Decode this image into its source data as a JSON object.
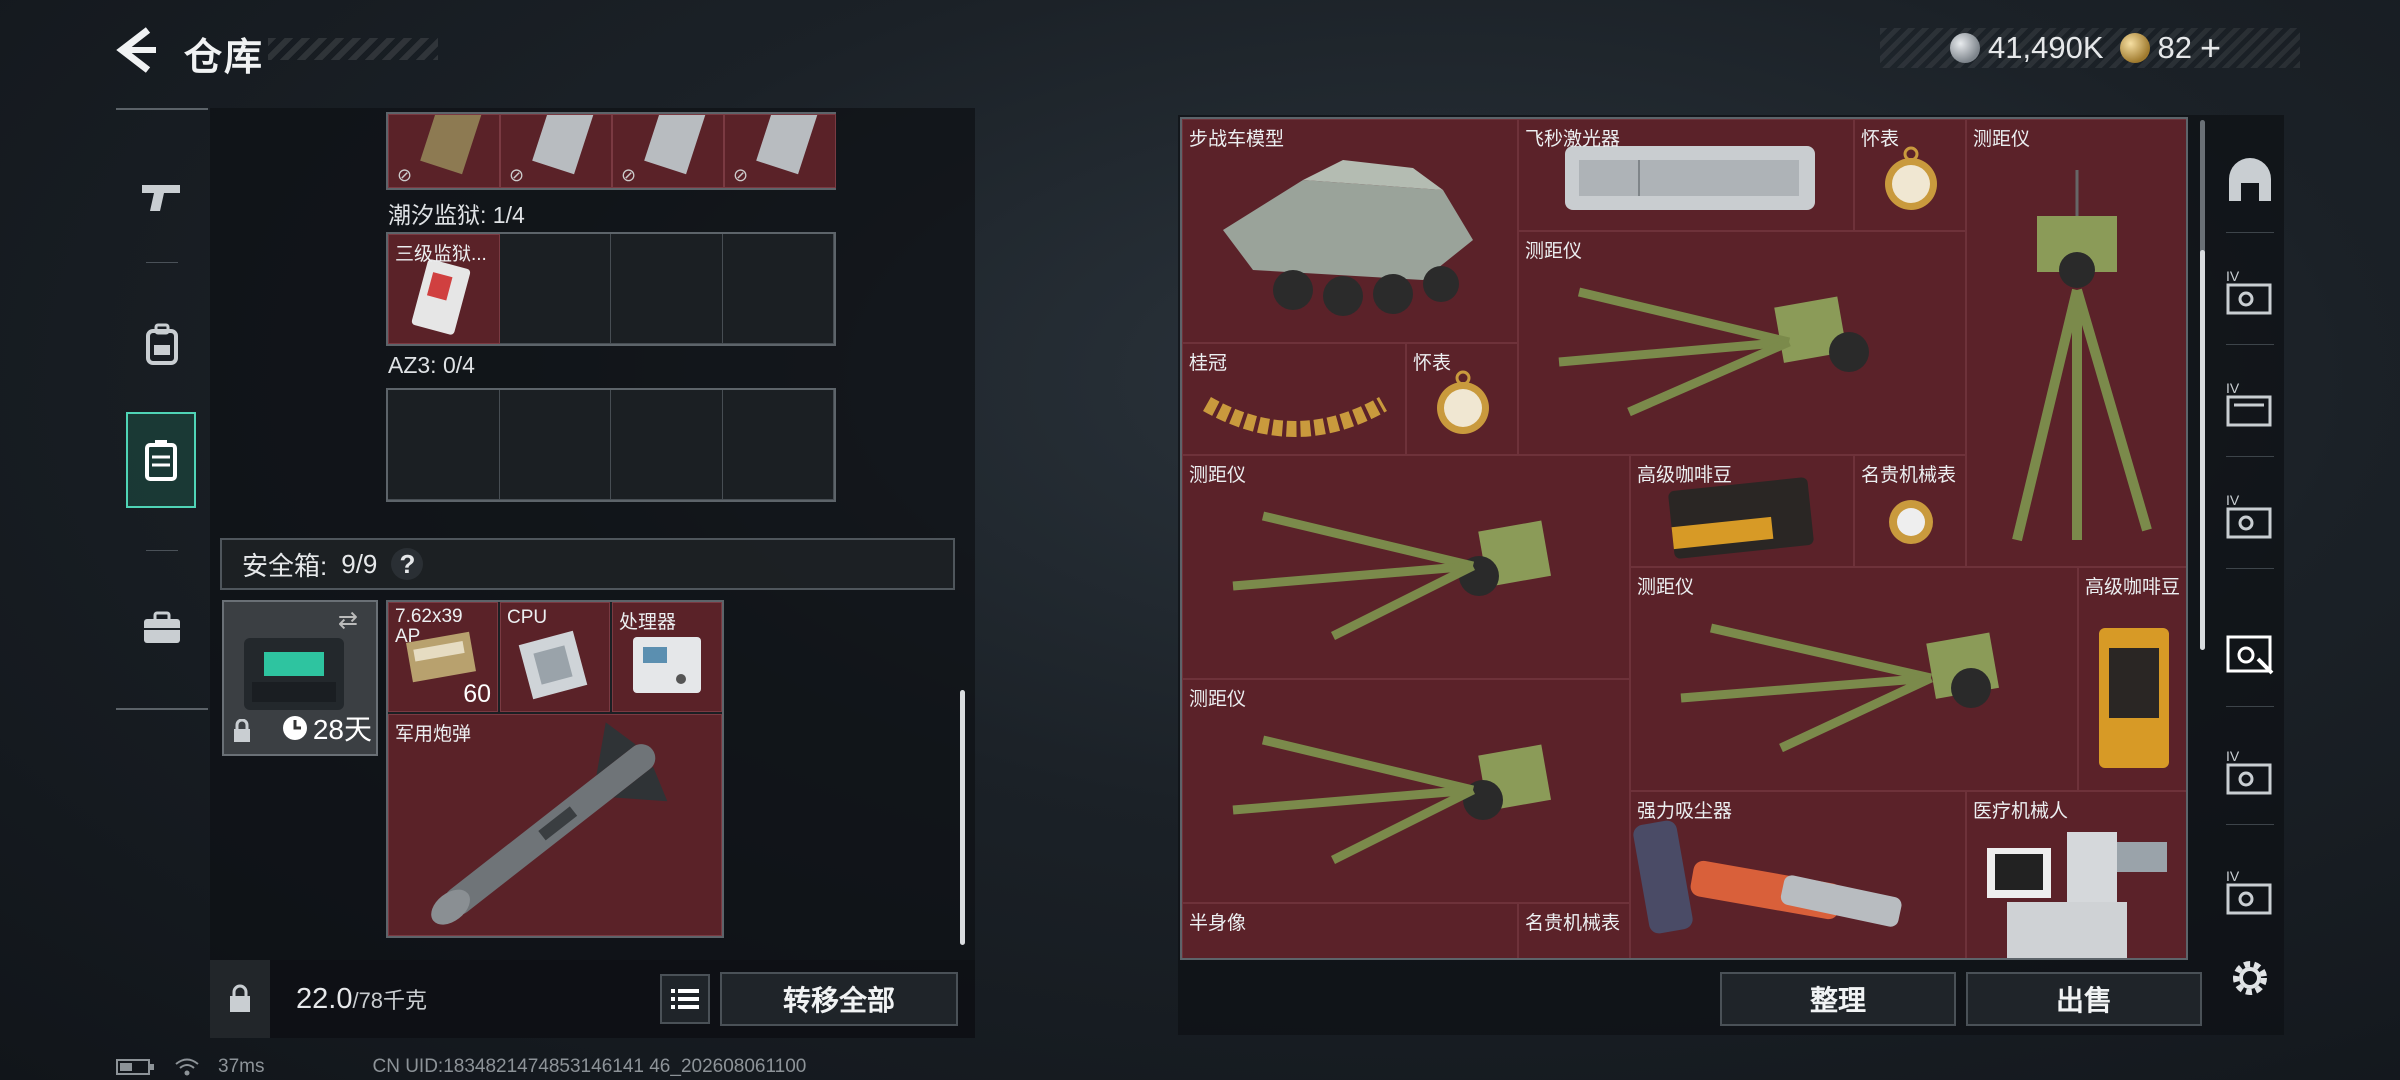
{
  "header": {
    "title": "仓库",
    "currency": [
      {
        "icon": "silver-coin-icon",
        "value": "41,490K"
      },
      {
        "icon": "gold-coin-icon",
        "value": "82"
      }
    ],
    "add_label": "+"
  },
  "left_rail": {
    "items": [
      {
        "icon": "pistol-icon"
      },
      {
        "icon": "backpack-icon"
      },
      {
        "icon": "safe-case-icon"
      },
      {
        "icon": "briefcase-icon"
      }
    ]
  },
  "loadout": {
    "tide_prison_label": "潮汐监狱: 1/4",
    "tide_prison_item": "三级监狱...",
    "az3_label": "AZ3: 0/4",
    "safe_box": {
      "label": "安全箱:",
      "count": "9/9",
      "help": "?",
      "days": "28天"
    },
    "safe_items": [
      {
        "name": "7.62x39 AP",
        "qty": "60"
      },
      {
        "name": "CPU"
      },
      {
        "name": "处理器"
      },
      {
        "name": "军用炮弹"
      }
    ],
    "weight_value": "22.0",
    "weight_max": "/78千克",
    "transfer_all": "转移全部"
  },
  "stash": {
    "items": [
      {
        "name": "步战车模型"
      },
      {
        "name": "飞秒激光器"
      },
      {
        "name": "怀表"
      },
      {
        "name": "测距仪"
      },
      {
        "name": "测距仪"
      },
      {
        "name": "桂冠"
      },
      {
        "name": "怀表"
      },
      {
        "name": "测距仪"
      },
      {
        "name": "高级咖啡豆"
      },
      {
        "name": "名贵机械表"
      },
      {
        "name": "测距仪"
      },
      {
        "name": "高级咖啡豆"
      },
      {
        "name": "测距仪"
      },
      {
        "name": "强力吸尘器"
      },
      {
        "name": "医疗机械人"
      },
      {
        "name": "半身像"
      },
      {
        "name": "名贵机械表"
      }
    ],
    "tidy_button": "整理",
    "sell_button": "出售"
  },
  "right_tabs": [
    {
      "icon": "dome-icon"
    },
    {
      "icon": "case-iv-icon",
      "label": "IV"
    },
    {
      "icon": "case-iv-icon",
      "label": "IV"
    },
    {
      "icon": "case-iv-icon",
      "label": "IV"
    },
    {
      "icon": "case-active-icon"
    },
    {
      "icon": "case-iv-icon",
      "label": "IV"
    },
    {
      "icon": "case-iv-icon",
      "label": "IV"
    }
  ],
  "status": {
    "ping": "37ms",
    "uid": "CN UID:1834821474853146141 46_202608061100"
  }
}
